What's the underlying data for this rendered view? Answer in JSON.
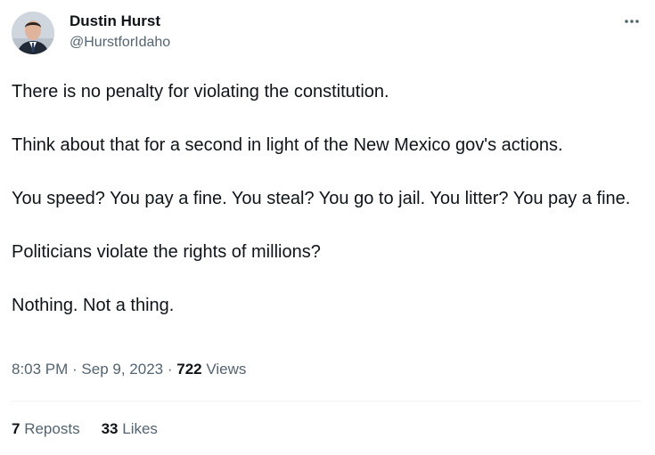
{
  "author": {
    "name": "Dustin Hurst",
    "handle": "@HurstforIdaho"
  },
  "tweet": {
    "paragraphs": [
      "There is no penalty for violating the constitution.",
      "Think about that for a second in light of the New Mexico gov's actions.",
      "You speed? You pay a fine. You steal? You go to jail. You litter? You pay a fine.",
      "Politicians violate the rights of millions?",
      "Nothing. Not a thing."
    ]
  },
  "meta": {
    "time": "8:03 PM",
    "sep1": " · ",
    "date": "Sep 9, 2023",
    "sep2": " · ",
    "views_count": "722",
    "views_label": "Views"
  },
  "stats": {
    "reposts_count": "7",
    "reposts_label": "Reposts",
    "likes_count": "33",
    "likes_label": "Likes"
  },
  "icons": {
    "more": "more-horizontal-icon"
  }
}
